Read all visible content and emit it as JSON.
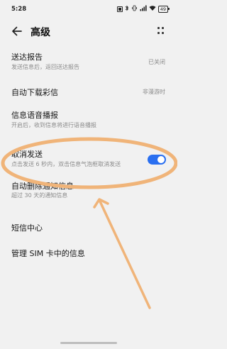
{
  "status": {
    "time": "5:28",
    "battery": "49"
  },
  "header": {
    "title": "高级"
  },
  "settings": [
    {
      "title": "送达报告",
      "subtitle": "发送信息后，返回送达报告",
      "value": "已关闭"
    },
    {
      "title": "自动下载彩信",
      "value": "非漫游时"
    },
    {
      "title": "信息语音播报",
      "subtitle": "开启后，收到信息将进行语音播报"
    },
    {
      "title": "取消发送",
      "subtitle": "点击发送 6 秒内，双击信息气泡框取消发送",
      "toggle": true
    },
    {
      "title": "自动删除通知信息",
      "subtitle": "超过 30 天的通知信息"
    },
    {
      "title": "短信中心"
    },
    {
      "title": "管理 SIM 卡中的信息"
    }
  ],
  "colors": {
    "accent": "#2a6ff0",
    "annotation": "#f0b479",
    "background": "#f1f1f1"
  }
}
